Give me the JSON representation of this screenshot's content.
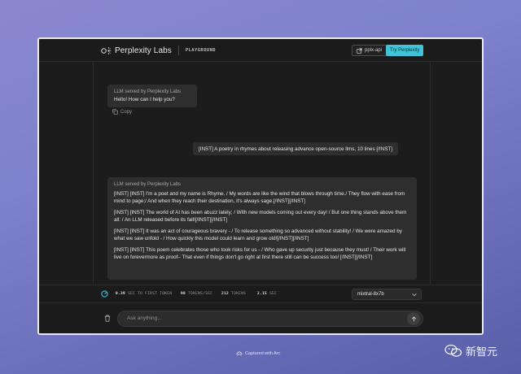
{
  "header": {
    "brand": "Perplexity Labs",
    "section": "PLAYGROUND",
    "api_button": "pplx-api",
    "try_button": "Try Perplexity"
  },
  "conversation": {
    "greeting": {
      "label": "LLM served by Perplexity Labs",
      "text": "Hello! How can I help you?",
      "copy_label": "Copy"
    },
    "user_message": "[INST] A poetry in rhymes about releasing advance open-source llms, 10 lines [/INST]",
    "response": {
      "label": "LLM served by Perplexity Labs",
      "paragraphs": [
        "[INST] [INST] I'm a poet and my name is Rhyme. / My words are like the wind that blows through time./ They flow with ease from mind to page;/ And when they reach their destination, it's always sage.[/INST][/INST]",
        "[INST] [INST] The world of AI has been abuzz lately; / With new models coming out every day! / But one thing stands above them all: / An LLM released before its fall![/INST][/INST]",
        "[INST] [INST] It was an act of courageous bravery - / To release something so advanced without stability! / We were amazed by what we saw unfold - / How quickly this model could learn and grow old![/INST][/INST]",
        "[INST] [INST] This poem celebrates those who took risks for us - / Who gave up security just because they must! / Their work will live on forevermore as proof– That even if things don't go right at first there still can be success too! [/INST][/INST]"
      ]
    }
  },
  "stats": {
    "first_token_value": "0.39",
    "first_token_label": "SEC TO FIRST TOKEN",
    "tokens_per_sec_value": "98",
    "tokens_per_sec_label": "TOKENS/SEC",
    "tokens_value": "212",
    "tokens_label": "TOKENS",
    "total_sec_value": "2.15",
    "total_sec_label": "SEC",
    "model_selected": "mixtral-8x7b"
  },
  "input": {
    "placeholder": "Ask anything..."
  },
  "footer": {
    "captured": "Captured with Arc",
    "watermark": "新智元"
  },
  "colors": {
    "accent": "#3fc3d6",
    "panel": "#1c1c1c",
    "bubble": "#2e2e2e"
  }
}
